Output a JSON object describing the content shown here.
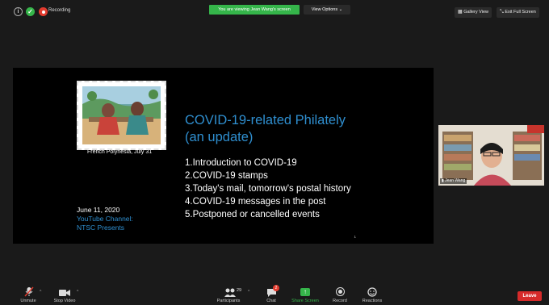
{
  "top_bar": {
    "recording_label": "Recording",
    "viewing_banner": "You are viewing Jean Wang's screen",
    "view_options": "View Options",
    "gallery_view": "Gallery View",
    "exit_full_screen": "Exit Full Screen"
  },
  "slide": {
    "stamp_caption": "French Polynesia, July 31",
    "title_line1": "COVID-19-related Philately",
    "title_line2": "(an update)",
    "items": [
      "1.Introduction to COVID-19",
      "2.COVID-19 stamps",
      "3.Today's mail, tomorrow's postal history",
      "4.COVID-19 messages in the post",
      "5.Postponed or cancelled events"
    ],
    "date": "June 11, 2020",
    "channel_line1": "YouTube Channel:",
    "channel_line2": "NTSC Presents",
    "slide_number": "1"
  },
  "speaker": {
    "name": "Jean Wang"
  },
  "toolbar": {
    "unmute": "Unmute",
    "stop_video": "Stop Video",
    "participants": "Participants",
    "participants_count": "29",
    "chat": "Chat",
    "chat_badge": "2",
    "share_screen": "Share Screen",
    "record": "Record",
    "reactions": "Reactions",
    "leave": "Leave"
  },
  "colors": {
    "share_green": "#35b54a",
    "leave_red": "#d62a2a",
    "title_blue": "#2f8fd0"
  }
}
